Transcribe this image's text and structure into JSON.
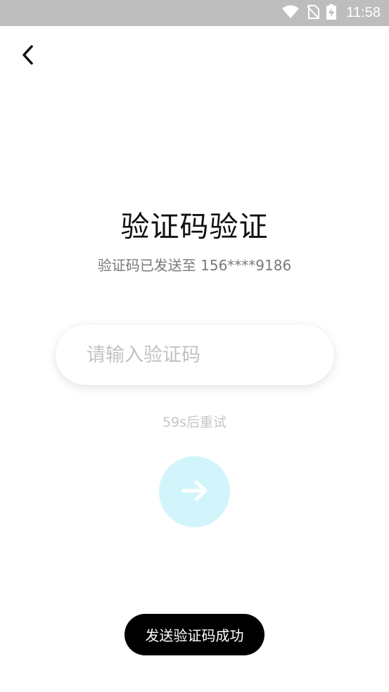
{
  "status_bar": {
    "time": "11:58",
    "icons": [
      "wifi-icon",
      "no-sim-icon",
      "battery-charging-icon"
    ]
  },
  "header": {
    "back_icon": "chevron-left-icon"
  },
  "main": {
    "title": "验证码验证",
    "subtitle": "验证码已发送至 156****9186",
    "code_input": {
      "value": "",
      "placeholder": "请输入验证码"
    },
    "retry_text": "59s后重试",
    "next_icon": "arrow-right-icon"
  },
  "toast": {
    "message": "发送验证码成功"
  },
  "colors": {
    "status_bar_bg": "#bdbdbd",
    "next_button_bg": "#d2f5fc",
    "toast_bg": "#000000"
  }
}
